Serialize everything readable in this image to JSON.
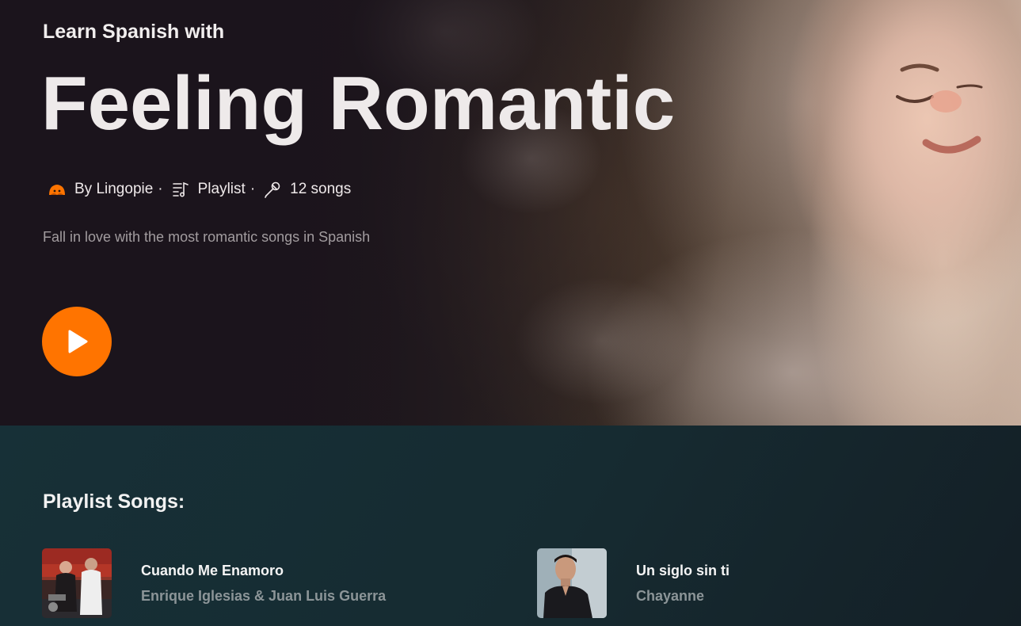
{
  "hero": {
    "kicker": "Learn Spanish with",
    "title": "Feeling Romantic",
    "meta": {
      "author_icon": "lingopie-logo-icon",
      "author": "By Lingopie",
      "separator": "·",
      "type_icon": "playlist-icon",
      "type": "Playlist",
      "count_icon": "microphone-icon",
      "count": "12 songs"
    },
    "description": "Fall in love with the most romantic songs in Spanish",
    "play_icon": "play-icon",
    "accent_color": "#ff7400"
  },
  "playlist": {
    "heading": "Playlist Songs:",
    "songs": [
      {
        "title": "Cuando Me Enamoro",
        "artist": "Enrique Iglesias & Juan Luis Guerra"
      },
      {
        "title": "Un siglo sin ti",
        "artist": "Chayanne"
      }
    ]
  }
}
